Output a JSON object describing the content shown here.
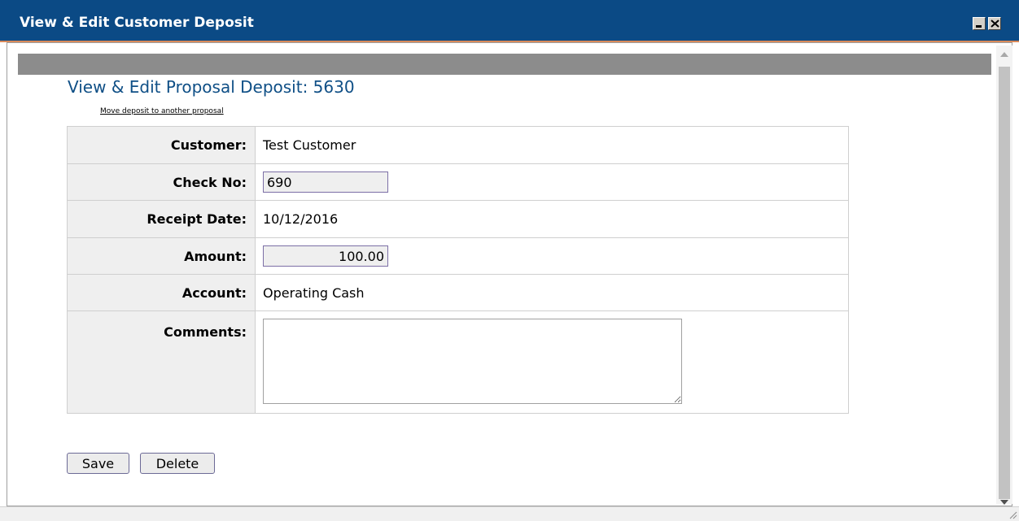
{
  "window": {
    "title": "View & Edit Customer Deposit"
  },
  "page": {
    "heading": "View & Edit Proposal Deposit: 5630",
    "move_link": "Move deposit to another proposal"
  },
  "form": {
    "customer_label": "Customer:",
    "customer_value": "Test Customer",
    "check_no_label": "Check No:",
    "check_no_value": "690",
    "receipt_date_label": "Receipt Date:",
    "receipt_date_value": "10/12/2016",
    "amount_label": "Amount:",
    "amount_value": "100.00",
    "account_label": "Account:",
    "account_value": "Operating Cash",
    "comments_label": "Comments:",
    "comments_value": ""
  },
  "buttons": {
    "save_label": "Save",
    "delete_label": "Delete"
  },
  "colors": {
    "titlebar": "#0b4a85",
    "heading": "#0f4f86",
    "label_bg": "#efefef",
    "gray_bar": "#8c8c8c"
  },
  "icons": {
    "minimize": "minimize-icon",
    "close": "close-icon",
    "scroll_up": "chevron-up-icon",
    "scroll_down": "chevron-down-icon",
    "resize": "resize-grip-icon"
  }
}
